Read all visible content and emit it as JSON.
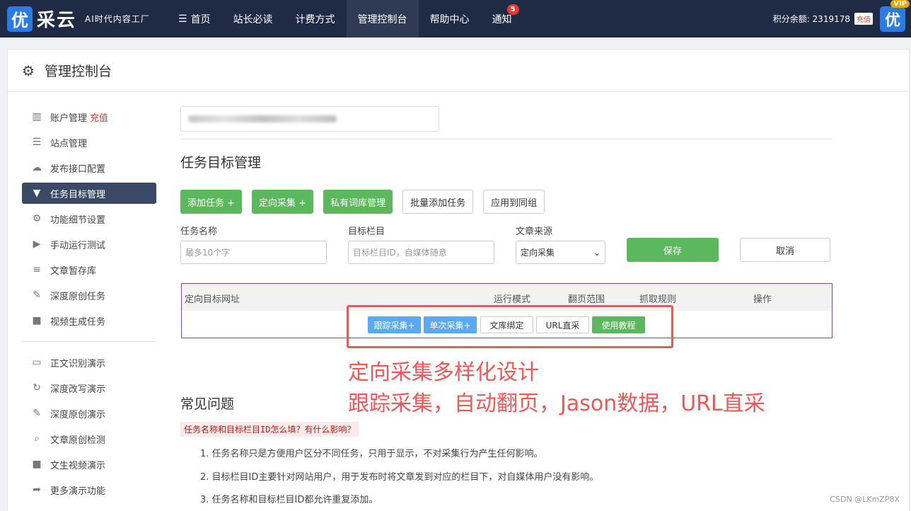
{
  "nav": {
    "logo_char": "优",
    "logo_text": "采云",
    "logo_sub": "AI时代内容工厂",
    "items": [
      {
        "label": "首页",
        "icon": "menu-icon"
      },
      {
        "label": "站长必读"
      },
      {
        "label": "计费方式"
      },
      {
        "label": "管理控制台",
        "active": true
      },
      {
        "label": "帮助中心"
      },
      {
        "label": "通知",
        "badge": "5"
      }
    ],
    "points_label": "积分余额: 2319178",
    "recharge": "充值",
    "vip_tag": "VIP",
    "avatar_char": "优"
  },
  "header": {
    "title": "管理控制台",
    "icon": "gear-icon"
  },
  "sidebar": {
    "items": [
      {
        "label": "账户管理",
        "extra": "充值",
        "icon": "bar-chart-icon"
      },
      {
        "label": "站点管理",
        "icon": "server-icon"
      },
      {
        "label": "发布接口配置",
        "icon": "cloud-upload-icon"
      },
      {
        "label": "任务目标管理",
        "icon": "filter-icon",
        "active": true
      },
      {
        "label": "功能细节设置",
        "icon": "gears-icon"
      },
      {
        "label": "手动运行测试",
        "icon": "play-icon"
      },
      {
        "label": "文章暂存库",
        "icon": "database-icon"
      },
      {
        "label": "深度原创任务",
        "icon": "edit-icon"
      },
      {
        "label": "视频生成任务",
        "icon": "video-icon"
      }
    ],
    "demo_items": [
      {
        "label": "正文识别演示",
        "icon": "monitor-icon"
      },
      {
        "label": "深度改写演示",
        "icon": "refresh-icon"
      },
      {
        "label": "深度原创演示",
        "icon": "edit-icon"
      },
      {
        "label": "文章原创检测",
        "icon": "search-icon"
      },
      {
        "label": "文生视频演示",
        "icon": "video-icon"
      },
      {
        "label": "更多演示功能",
        "icon": "share-icon"
      }
    ]
  },
  "content": {
    "section_title": "任务目标管理",
    "buttons": {
      "add_task": "添加任务 +",
      "directed": "定向采集 +",
      "private_dict": "私有词库管理",
      "batch_add": "批量添加任务",
      "apply_group": "应用到同组"
    },
    "form": {
      "task_name_label": "任务名称",
      "task_name_placeholder": "最多10个字",
      "column_label": "目标栏目",
      "column_placeholder": "目标栏目ID，自媒体随意",
      "source_label": "文章来源",
      "source_value": "定向采集",
      "save": "保存",
      "cancel": "取消"
    },
    "table": {
      "headers": [
        "定向目标网址",
        "运行模式",
        "翻页范围",
        "抓取规则",
        "操作"
      ],
      "row_buttons": [
        "跟踪采集+",
        "单次采集+",
        "文库绑定",
        "URL直采",
        "使用教程"
      ]
    }
  },
  "annotation": {
    "line1": "定向采集多样化设计",
    "line2": "跟踪采集，自动翻页，Jason数据，URL直采"
  },
  "faq": {
    "title": "常见问题",
    "question": "任务名称和目标栏目ID怎么填？有什么影响？",
    "answers": [
      "1. 任务名称只是方便用户区分不同任务，只用于显示，不对采集行为产生任何影响。",
      "2. 目标栏目ID主要针对网站用户，用于发布时将文章发到对应的栏目下，对自媒体用户没有影响。",
      "3. 任务名称和目标栏目ID都允许重复添加。"
    ]
  },
  "watermark": "CSDN @LKmZP8X",
  "colors": {
    "nav_bg": "#1f2a44",
    "accent_green": "#5cb85c",
    "annotation_red": "#f25757",
    "active_side": "#3a4a66"
  }
}
